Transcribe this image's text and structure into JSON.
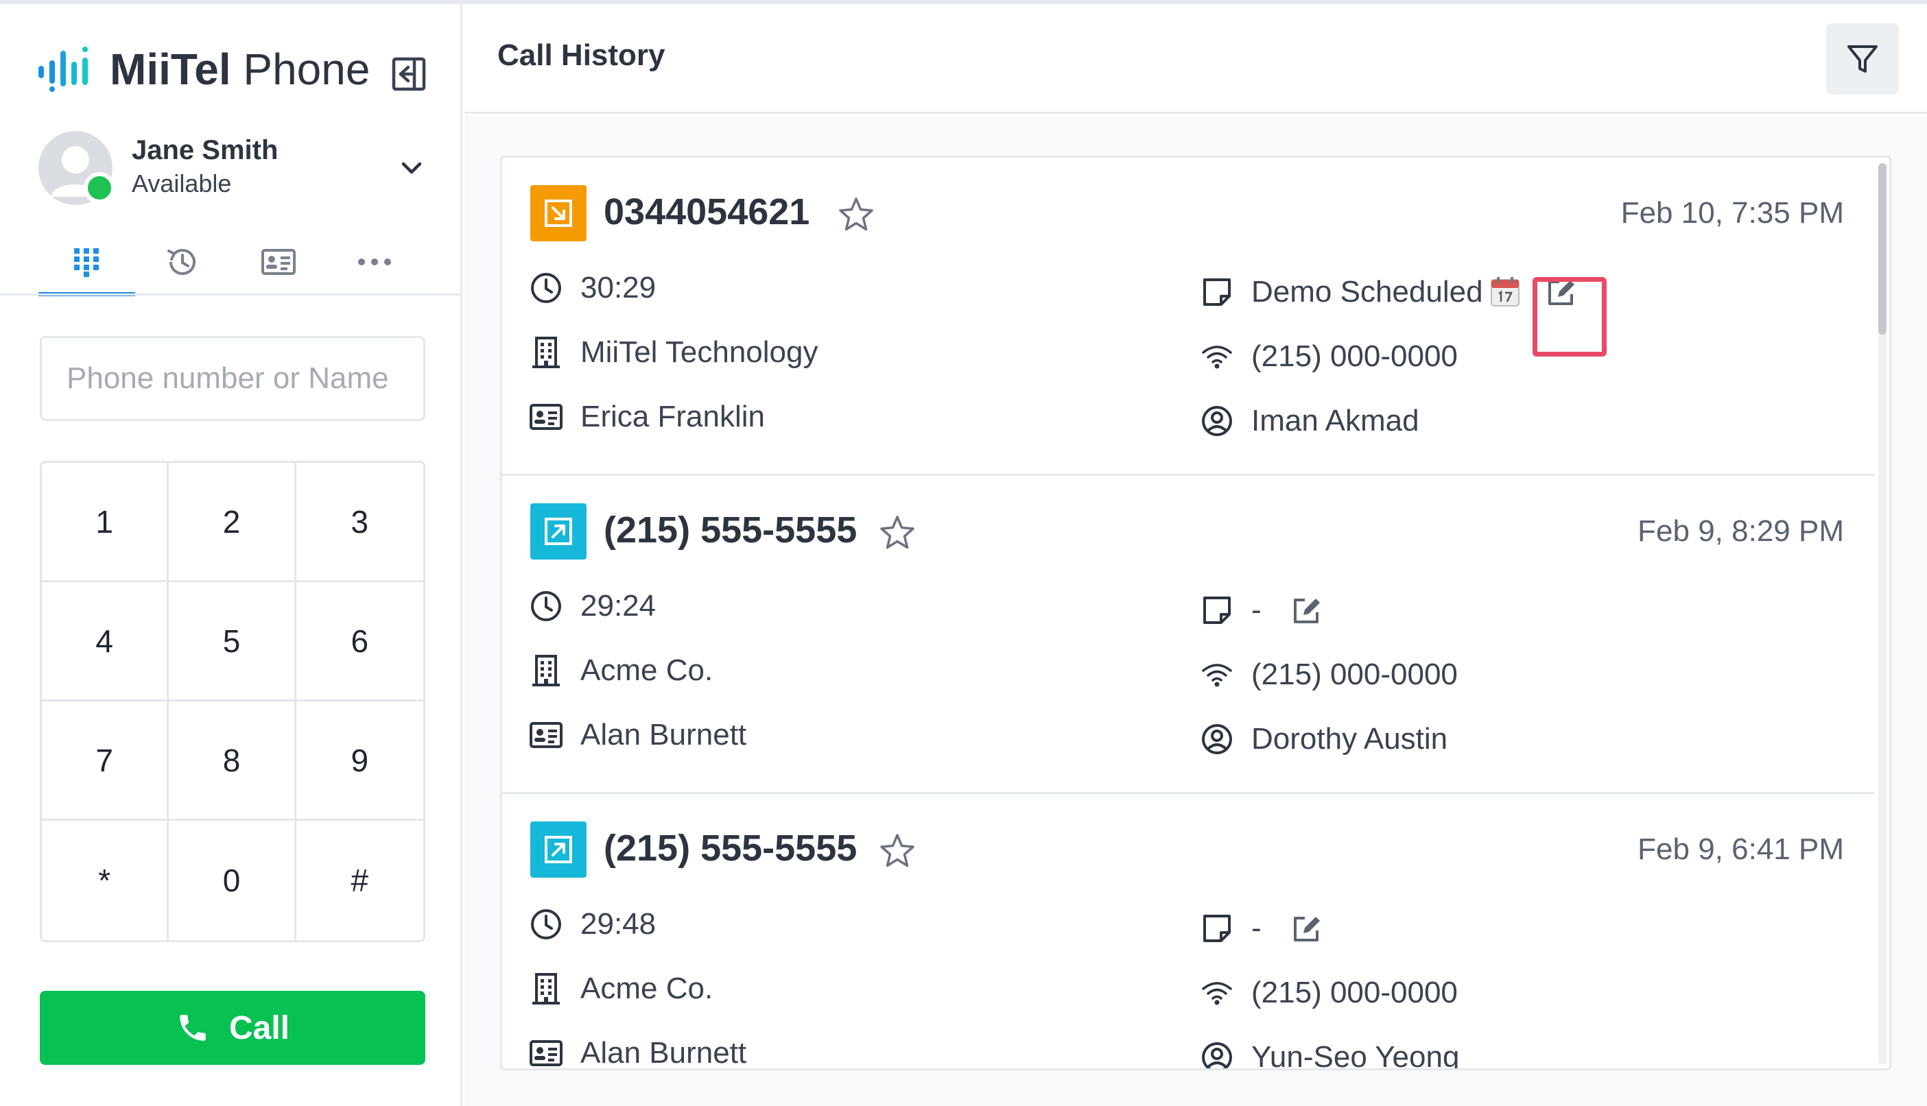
{
  "brand": {
    "name_bold": "MiiTel",
    "name_regular": "Phone"
  },
  "user": {
    "name": "Jane Smith",
    "status": "Available"
  },
  "nav": {
    "tabs": [
      "keypad-icon",
      "history-icon",
      "contact-card-icon",
      "more-icon"
    ],
    "active": 0
  },
  "dialer": {
    "placeholder": "Phone number or Name",
    "keys": [
      "1",
      "2",
      "3",
      "4",
      "5",
      "6",
      "7",
      "8",
      "9",
      "*",
      "0",
      "#"
    ],
    "call_label": "Call"
  },
  "header": {
    "title": "Call History"
  },
  "colors": {
    "outbound": "#f59a00",
    "inbound": "#15b8d8",
    "call_button": "#07c153",
    "accent": "#1f8fe6",
    "highlight": "#e94a65"
  },
  "calls": [
    {
      "direction": "outbound",
      "number": "0344054621",
      "date": "Feb 10, 7:35 PM",
      "duration": "30:29",
      "company": "MiiTel Technology",
      "contact": "Erica Franklin",
      "memo": "Demo Scheduled",
      "line": "(215) 000-0000",
      "agent": "Iman Akmad"
    },
    {
      "direction": "inbound",
      "number": "(215) 555-5555",
      "date": "Feb 9, 8:29 PM",
      "duration": "29:24",
      "company": "Acme Co.",
      "contact": "Alan Burnett",
      "memo": "-",
      "line": "(215) 000-0000",
      "agent": "Dorothy Austin"
    },
    {
      "direction": "inbound",
      "number": "(215) 555-5555",
      "date": "Feb 9, 6:41 PM",
      "duration": "29:48",
      "company": "Acme Co.",
      "contact": "Alan Burnett",
      "memo": "-",
      "line": "(215) 000-0000",
      "agent": "Yun-Seo Yeong"
    }
  ]
}
